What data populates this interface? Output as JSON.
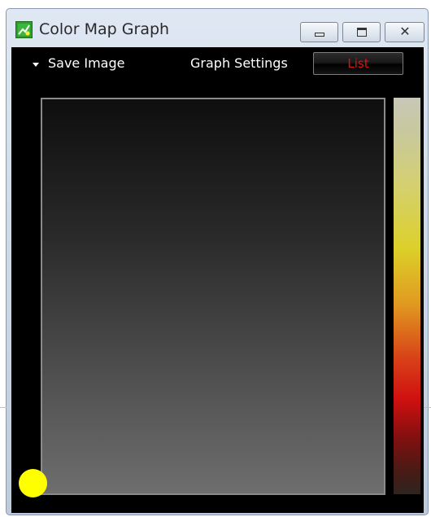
{
  "window": {
    "title": "Color Map Graph",
    "icons": {
      "app": "graph-app-icon",
      "minimize": "minimize-icon",
      "maximize": "maximize-icon",
      "close": "close-icon"
    }
  },
  "toolbar": {
    "save_image_label": "Save Image",
    "graph_settings_label": "Graph Settings",
    "list_label": "List",
    "list_color": "#e01010"
  },
  "graph": {
    "marker_color": "#ffff00",
    "colorbar_colors": [
      "#c8c8b8",
      "#dcd02a",
      "#e09a20",
      "#d01010",
      "#2e2420"
    ]
  }
}
